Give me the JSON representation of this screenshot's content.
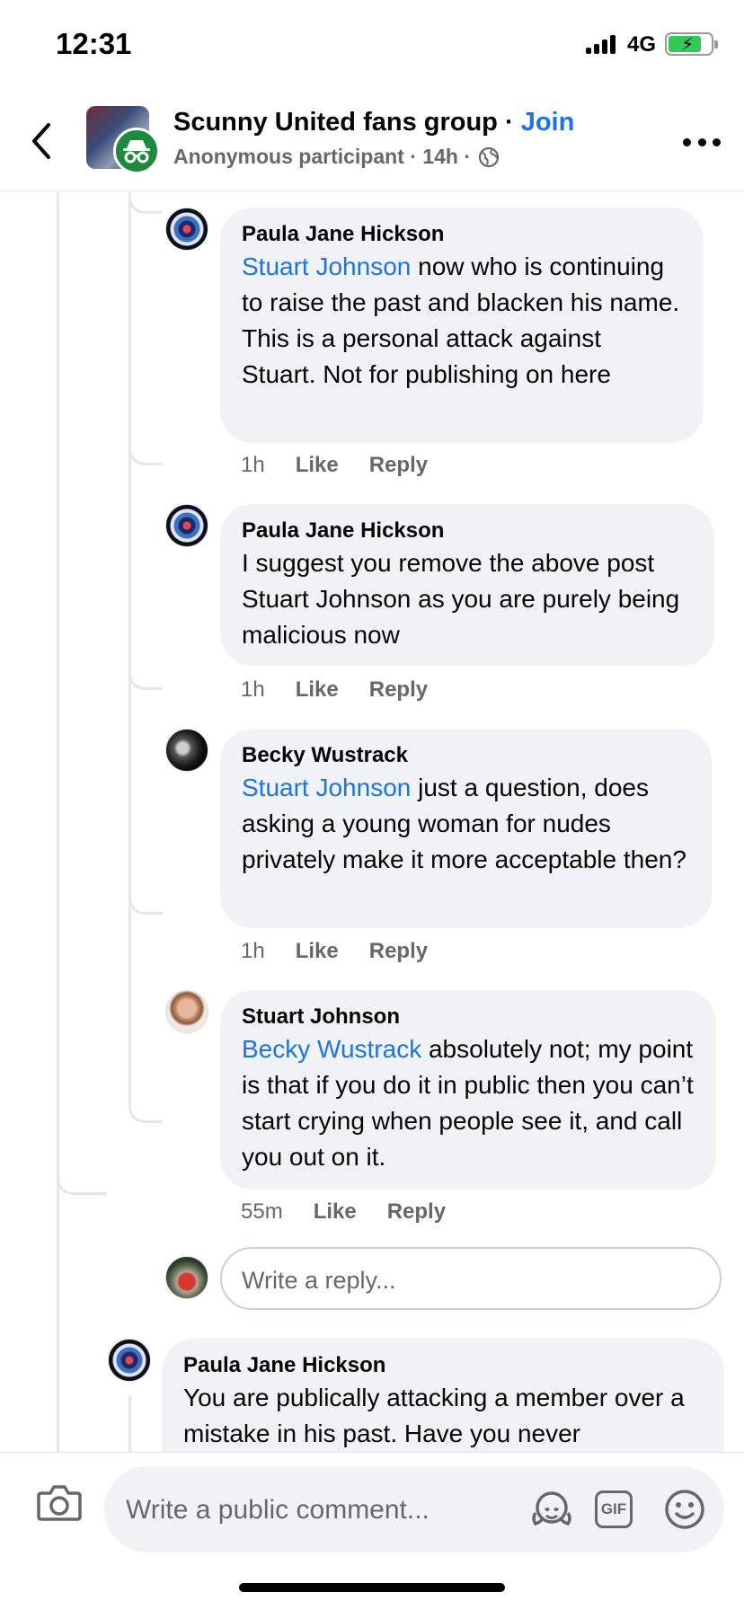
{
  "status_bar": {
    "time": "12:31",
    "network": "4G"
  },
  "header": {
    "group_name": "Scunny United fans group",
    "separator": " · ",
    "join_label": "Join",
    "subtitle": "Anonymous participant · 14h ·"
  },
  "comments": [
    {
      "author": "Paula Jane Hickson",
      "mention": "Stuart Johnson",
      "text": " now who is continuing to raise the past and blacken his name. This is a personal attack against Stuart. Not for publishing on here",
      "time": "1h",
      "like_label": "Like",
      "reply_label": "Reply"
    },
    {
      "author": "Paula Jane Hickson",
      "mention": "",
      "text": "I suggest you remove the above post Stuart Johnson as you are purely being malicious now",
      "time": "1h",
      "like_label": "Like",
      "reply_label": "Reply"
    },
    {
      "author": "Becky Wustrack",
      "mention": "Stuart Johnson",
      "text": " just a question, does asking a young woman for nudes privately make it more acceptable then?",
      "time": "1h",
      "like_label": "Like",
      "reply_label": "Reply"
    },
    {
      "author": "Stuart Johnson",
      "mention": "Becky Wustrack",
      "text": " absolutely not; my point is that if you do it in public then you can’t start crying when people see it, and call you out on it.",
      "time": "55m",
      "like_label": "Like",
      "reply_label": "Reply"
    },
    {
      "author": "Paula Jane Hickson",
      "mention": "",
      "text": "You are publically attacking a member over a mistake in his past. Have you never"
    }
  ],
  "reply_box": {
    "placeholder": "Write a reply..."
  },
  "composer": {
    "placeholder": "Write a public comment...",
    "gif_label": "GIF"
  },
  "icons": {
    "back": "chevron-left-icon",
    "more": "more-icon",
    "globe": "globe-icon",
    "anonymous": "incognito-icon",
    "camera": "camera-icon",
    "avatar_frame": "avatar-frame-icon",
    "gif": "gif-icon",
    "emoji": "emoji-icon"
  },
  "colors": {
    "link": "#1b74e4",
    "bubble": "#f0f2f5",
    "meta": "#65676b",
    "anon_badge": "#1e8a3d",
    "battery": "#34c759"
  }
}
